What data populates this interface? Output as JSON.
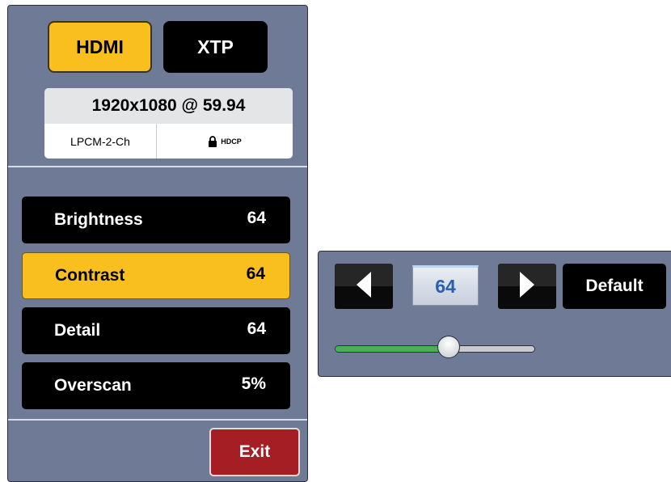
{
  "inputs": {
    "active_label": "HDMI",
    "inactive_label": "XTP"
  },
  "signal": {
    "resolution": "1920x1080 @ 59.94",
    "audio": "LPCM-2-Ch",
    "hdcp": "HDCP"
  },
  "params": [
    {
      "label": "Brightness",
      "value": "64"
    },
    {
      "label": "Contrast",
      "value": "64"
    },
    {
      "label": "Detail",
      "value": "64"
    },
    {
      "label": "Overscan",
      "value": "5%"
    }
  ],
  "selected_param": "Contrast",
  "exit_label": "Exit",
  "adjust": {
    "value": "64",
    "default_label": "Default",
    "slider_fraction": 0.57
  },
  "colors": {
    "panel": "#6e7a96",
    "accent": "#f9bf1e",
    "exit": "#a41e23",
    "slider_fill": "#4cb04f",
    "value_text": "#2a5fb0"
  }
}
